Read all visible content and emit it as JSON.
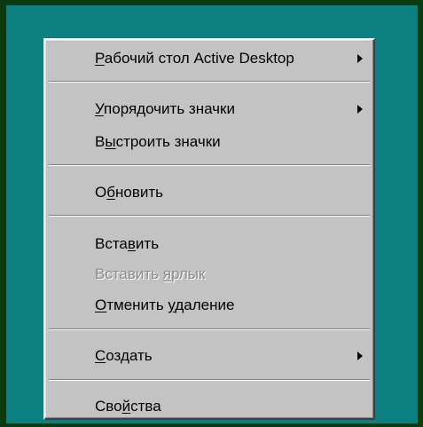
{
  "menu": {
    "items": [
      {
        "before": "",
        "mnemonic": "Р",
        "after": "абочий стол Active Desktop",
        "has_submenu": true,
        "disabled": false
      },
      {
        "before": "",
        "mnemonic": "У",
        "after": "порядочить значки",
        "has_submenu": true,
        "disabled": false
      },
      {
        "before": "В",
        "mnemonic": "ы",
        "after": "строить значки",
        "has_submenu": false,
        "disabled": false
      },
      {
        "before": "О",
        "mnemonic": "б",
        "after": "новить",
        "has_submenu": false,
        "disabled": false
      },
      {
        "before": "Вста",
        "mnemonic": "в",
        "after": "ить",
        "has_submenu": false,
        "disabled": false
      },
      {
        "before": "Вставить ",
        "mnemonic": "я",
        "after": "рлык",
        "has_submenu": false,
        "disabled": true
      },
      {
        "before": "",
        "mnemonic": "О",
        "after": "тменить ",
        "mnemonic2": "у",
        "after2": "даление",
        "has_submenu": false,
        "disabled": false
      },
      {
        "before": "",
        "mnemonic": "С",
        "after": "оздать",
        "has_submenu": true,
        "disabled": false
      },
      {
        "before": "Сво",
        "mnemonic": "й",
        "after": "ства",
        "has_submenu": false,
        "disabled": false
      }
    ]
  },
  "colors": {
    "desktop": "#0b8080",
    "outer_frame": "#0b3a10",
    "menu_face": "#c3c3c3",
    "disabled_text": "#8c8c8c"
  }
}
